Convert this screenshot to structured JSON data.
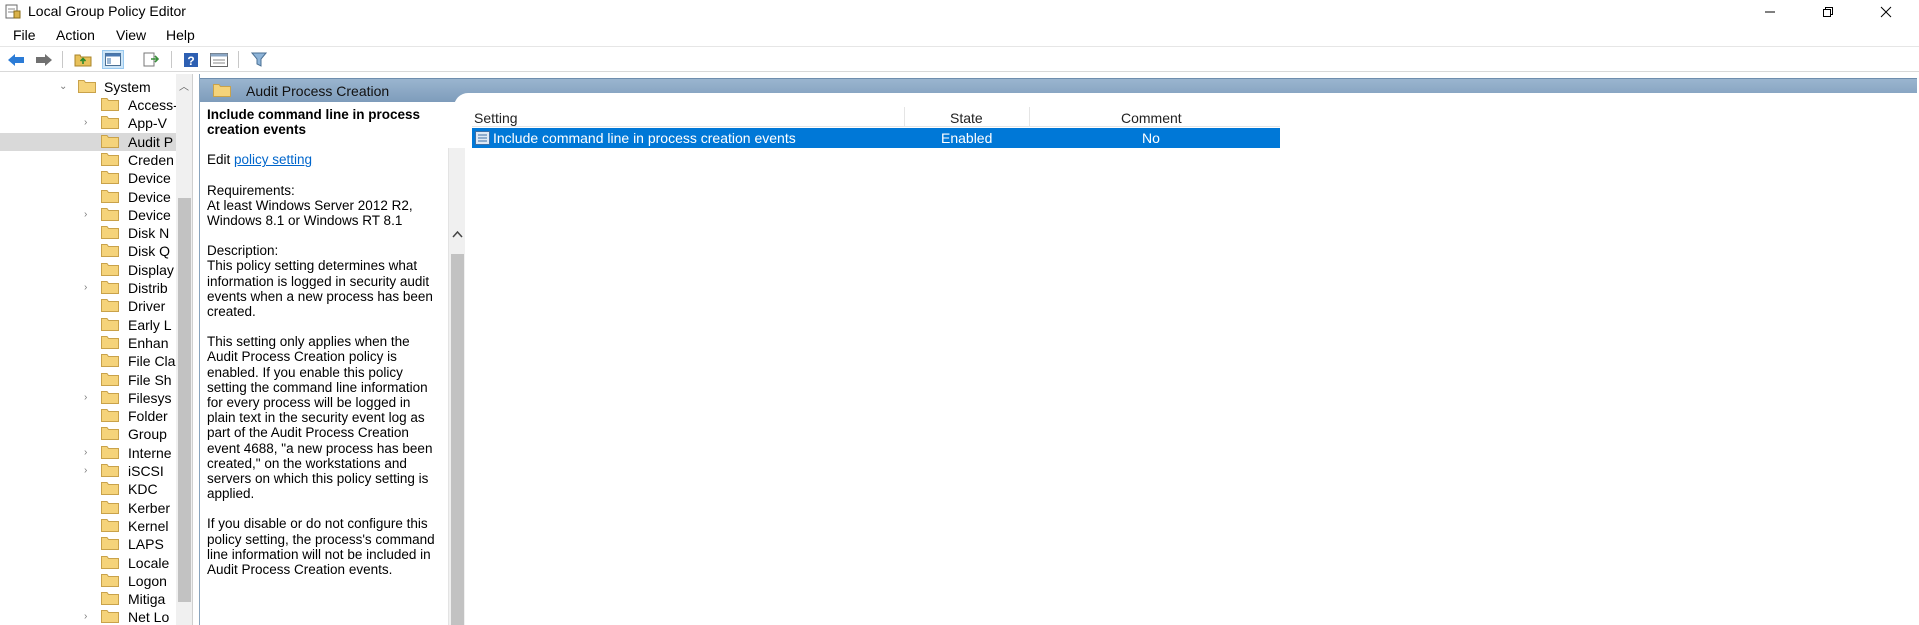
{
  "window": {
    "title": "Local Group Policy Editor",
    "controls": [
      "minimize",
      "restore",
      "close"
    ]
  },
  "menu": {
    "items": [
      "File",
      "Action",
      "View",
      "Help"
    ]
  },
  "toolbar": {
    "buttons": [
      {
        "icon": "back-arrow-icon"
      },
      {
        "icon": "forward-arrow-icon"
      },
      {
        "icon": "up-folder-icon"
      },
      {
        "icon": "show-hide-console-tree-icon",
        "pressed": true
      },
      {
        "icon": "export-list-icon"
      },
      {
        "icon": "help-icon"
      },
      {
        "icon": "properties-icon"
      },
      {
        "icon": "filter-icon"
      }
    ]
  },
  "tree": {
    "root": {
      "label": "System",
      "expanded": true
    },
    "items": [
      {
        "label": "Access-",
        "expandable": false
      },
      {
        "label": "App-V",
        "expandable": true
      },
      {
        "label": "Audit P",
        "expandable": false,
        "selected": true
      },
      {
        "label": "Creden",
        "expandable": false
      },
      {
        "label": "Device",
        "expandable": false
      },
      {
        "label": "Device",
        "expandable": false
      },
      {
        "label": "Device",
        "expandable": true
      },
      {
        "label": "Disk N",
        "expandable": false
      },
      {
        "label": "Disk Q",
        "expandable": false
      },
      {
        "label": "Display",
        "expandable": false
      },
      {
        "label": "Distrib",
        "expandable": true
      },
      {
        "label": "Driver",
        "expandable": false
      },
      {
        "label": "Early L",
        "expandable": false
      },
      {
        "label": "Enhan",
        "expandable": false
      },
      {
        "label": "File Cla",
        "expandable": false
      },
      {
        "label": "File Sh",
        "expandable": false
      },
      {
        "label": "Filesys",
        "expandable": true
      },
      {
        "label": "Folder",
        "expandable": false
      },
      {
        "label": "Group",
        "expandable": false
      },
      {
        "label": "Interne",
        "expandable": true
      },
      {
        "label": "iSCSI",
        "expandable": true
      },
      {
        "label": "KDC",
        "expandable": false
      },
      {
        "label": "Kerber",
        "expandable": false
      },
      {
        "label": "Kernel",
        "expandable": false
      },
      {
        "label": "LAPS",
        "expandable": false
      },
      {
        "label": "Locale",
        "expandable": false
      },
      {
        "label": "Logon",
        "expandable": false
      },
      {
        "label": "Mitiga",
        "expandable": false
      },
      {
        "label": "Net Lo",
        "expandable": true
      }
    ]
  },
  "header": {
    "title": "Audit Process Creation"
  },
  "description": {
    "heading": "Include command line in process creation events",
    "edit_prefix": "Edit ",
    "edit_link": "policy setting ",
    "requirements_label": "Requirements:",
    "requirements_text": "At least Windows Server 2012 R2, Windows 8.1 or Windows RT 8.1",
    "description_label": "Description:",
    "para1": "This policy setting determines what information is logged in security audit events when a new process has been created.",
    "para2": "This setting only applies when the Audit Process Creation policy is enabled. If you enable this policy setting the command line information for every process will be logged in plain text in the security event log as part of the Audit Process Creation event 4688, \"a new process has been created,\" on the workstations and servers on which this policy setting is applied.",
    "para3": "If you disable or do not configure this policy setting, the process's command line information will not be included in Audit Process Creation events."
  },
  "table": {
    "columns": [
      "Setting",
      "State",
      "Comment"
    ],
    "rows": [
      {
        "setting": "Include command line in process creation events",
        "state": "Enabled",
        "comment": "No",
        "selected": true
      }
    ]
  },
  "colors": {
    "selection": "#0078d7",
    "header_band": "#8aa8c6",
    "link": "#0066cc"
  }
}
